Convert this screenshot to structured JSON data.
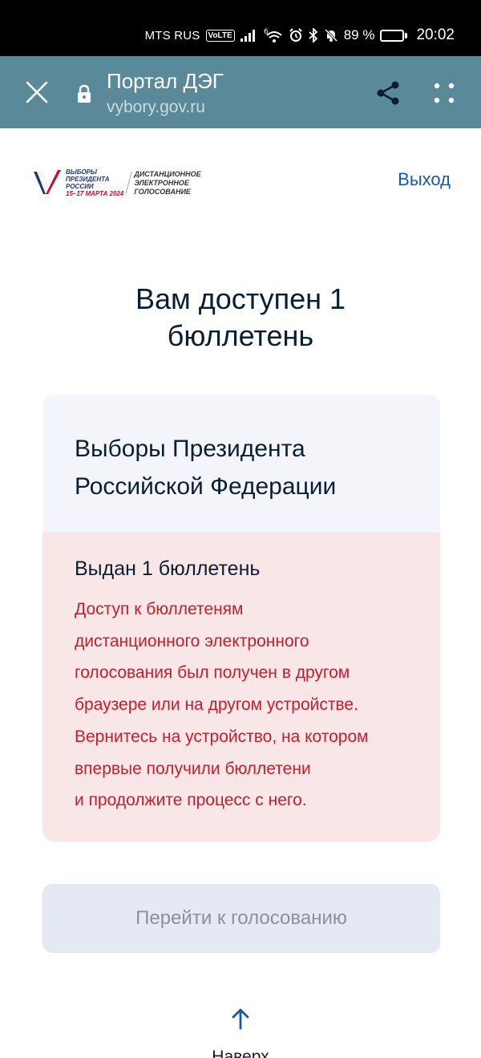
{
  "status_bar": {
    "carrier": "MTS RUS",
    "volte": "VoLTE",
    "network_badge": "6",
    "battery_percent": "89 %",
    "battery_level": 0.89,
    "time": "20:02"
  },
  "browser": {
    "title": "Портал ДЭГ",
    "url": "vybory.gov.ru"
  },
  "header": {
    "logo_line1": "ВЫБОРЫ",
    "logo_line2": "ПРЕЗИДЕНТА",
    "logo_line3": "РОССИИ",
    "logo_date": "15–17 МАРТА 2024",
    "logo_right1": "ДИСТАНЦИОННОЕ",
    "logo_right2": "ЭЛЕКТРОННОЕ",
    "logo_right3": "ГОЛОСОВАНИЕ",
    "logout_label": "Выход"
  },
  "main": {
    "heading_line1": "Вам доступен 1",
    "heading_line2": "бюллетень",
    "card": {
      "title_line1": "Выборы Президента",
      "title_line2": "Российской Федерации",
      "issued": "Выдан 1 бюллетень",
      "warning_lines": [
        "Доступ к бюллетеням",
        "дистанционного электронного",
        "голосования был получен в другом",
        "браузере или на другом устройстве.",
        "Вернитесь на устройство, на котором",
        "впервые получили бюллетени",
        "и продолжите процесс с него."
      ]
    },
    "vote_button_label": "Перейти к голосованию",
    "to_top_label": "Наверх"
  },
  "colors": {
    "browser_bar": "#5a8a99",
    "warning_bg": "#f9e7e8",
    "warning_text": "#c3202e",
    "link": "#1a56b0",
    "card_top_bg": "#f3f5fa",
    "disabled_button_bg": "#e5e9f3"
  },
  "icons": [
    "close-icon",
    "lock-icon",
    "share-icon",
    "more-vertical-icon",
    "arrow-up-icon",
    "signal-icon",
    "wifi-icon",
    "alarm-icon",
    "bluetooth-icon",
    "mute-icon",
    "battery-icon"
  ]
}
